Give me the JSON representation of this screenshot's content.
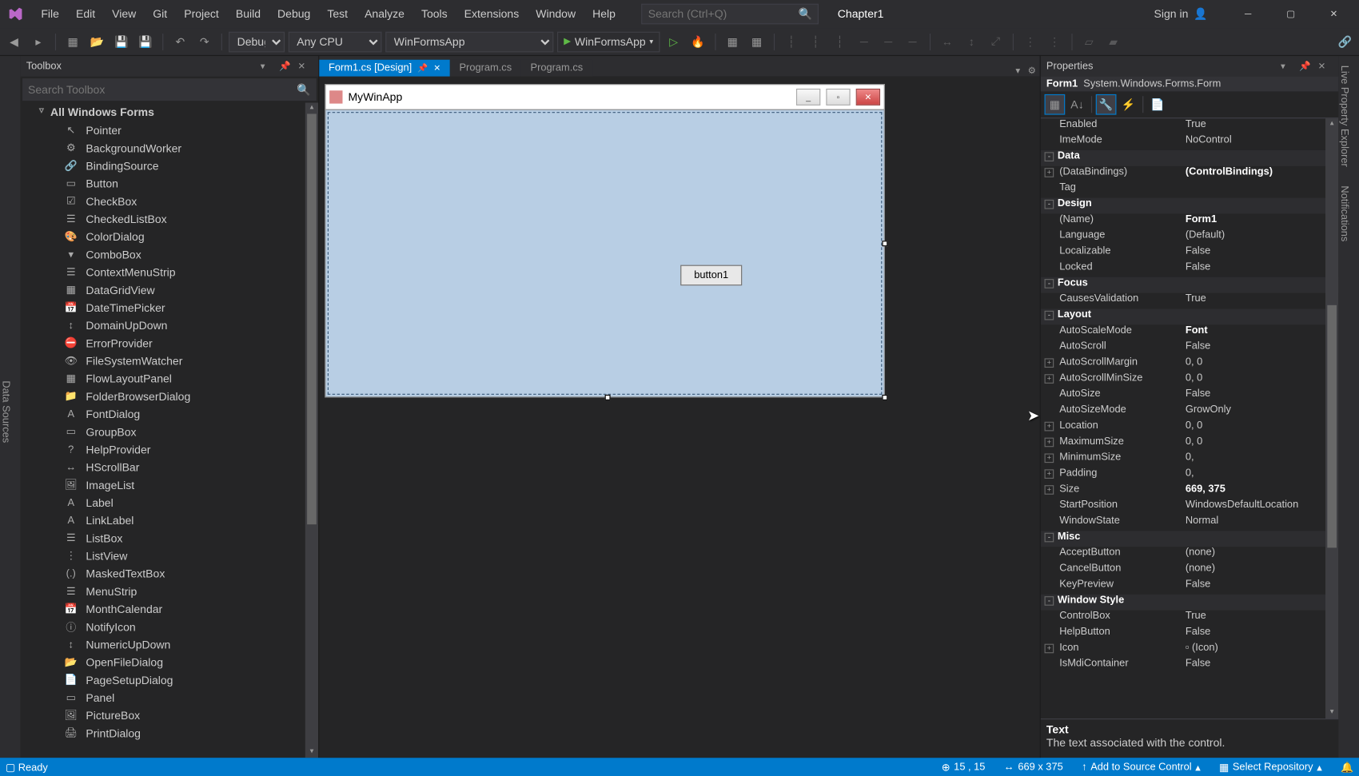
{
  "title": {
    "menu": [
      "File",
      "Edit",
      "View",
      "Git",
      "Project",
      "Build",
      "Debug",
      "Test",
      "Analyze",
      "Tools",
      "Extensions",
      "Window",
      "Help"
    ],
    "search_placeholder": "Search (Ctrl+Q)",
    "solution": "Chapter1",
    "signin": "Sign in"
  },
  "toolbar": {
    "config": "Debug",
    "platform": "Any CPU",
    "startup": "WinFormsApp",
    "run": "WinFormsApp"
  },
  "toolbox": {
    "title": "Toolbox",
    "search_placeholder": "Search Toolbox",
    "category": "All Windows Forms",
    "items": [
      "Pointer",
      "BackgroundWorker",
      "BindingSource",
      "Button",
      "CheckBox",
      "CheckedListBox",
      "ColorDialog",
      "ComboBox",
      "ContextMenuStrip",
      "DataGridView",
      "DateTimePicker",
      "DomainUpDown",
      "ErrorProvider",
      "FileSystemWatcher",
      "FlowLayoutPanel",
      "FolderBrowserDialog",
      "FontDialog",
      "GroupBox",
      "HelpProvider",
      "HScrollBar",
      "ImageList",
      "Label",
      "LinkLabel",
      "ListBox",
      "ListView",
      "MaskedTextBox",
      "MenuStrip",
      "MonthCalendar",
      "NotifyIcon",
      "NumericUpDown",
      "OpenFileDialog",
      "PageSetupDialog",
      "Panel",
      "PictureBox",
      "PrintDialog"
    ]
  },
  "tabs": {
    "active": "Form1.cs [Design]",
    "others": [
      "Program.cs",
      "Program.cs"
    ]
  },
  "form": {
    "title": "MyWinApp",
    "button": "button1"
  },
  "properties": {
    "title": "Properties",
    "object_name": "Form1",
    "object_type": "System.Windows.Forms.Form",
    "rows": [
      {
        "name": "Enabled",
        "val": "True",
        "cat": false
      },
      {
        "name": "ImeMode",
        "val": "NoControl",
        "cat": false
      },
      {
        "name": "Data",
        "val": "",
        "cat": true
      },
      {
        "name": "(DataBindings)",
        "val": "(ControlBindings)",
        "bold": true,
        "exp": true
      },
      {
        "name": "Tag",
        "val": ""
      },
      {
        "name": "Design",
        "val": "",
        "cat": true
      },
      {
        "name": "(Name)",
        "val": "Form1",
        "bold": true
      },
      {
        "name": "Language",
        "val": "(Default)"
      },
      {
        "name": "Localizable",
        "val": "False"
      },
      {
        "name": "Locked",
        "val": "False"
      },
      {
        "name": "Focus",
        "val": "",
        "cat": true
      },
      {
        "name": "CausesValidation",
        "val": "True"
      },
      {
        "name": "Layout",
        "val": "",
        "cat": true
      },
      {
        "name": "AutoScaleMode",
        "val": "Font",
        "bold": true
      },
      {
        "name": "AutoScroll",
        "val": "False"
      },
      {
        "name": "AutoScrollMargin",
        "val": "0, 0",
        "exp": true
      },
      {
        "name": "AutoScrollMinSize",
        "val": "0, 0",
        "exp": true
      },
      {
        "name": "AutoSize",
        "val": "False"
      },
      {
        "name": "AutoSizeMode",
        "val": "GrowOnly"
      },
      {
        "name": "Location",
        "val": "0, 0",
        "exp": true
      },
      {
        "name": "MaximumSize",
        "val": "0, 0",
        "exp": true
      },
      {
        "name": "MinimumSize",
        "val": "0,",
        "exp": true
      },
      {
        "name": "Padding",
        "val": "0,",
        "exp": true
      },
      {
        "name": "Size",
        "val": "669, 375",
        "bold": true,
        "exp": true
      },
      {
        "name": "StartPosition",
        "val": "WindowsDefaultLocation"
      },
      {
        "name": "WindowState",
        "val": "Normal"
      },
      {
        "name": "Misc",
        "val": "",
        "cat": true
      },
      {
        "name": "AcceptButton",
        "val": "(none)"
      },
      {
        "name": "CancelButton",
        "val": "(none)"
      },
      {
        "name": "KeyPreview",
        "val": "False"
      },
      {
        "name": "Window Style",
        "val": "",
        "cat": true
      },
      {
        "name": "ControlBox",
        "val": "True"
      },
      {
        "name": "HelpButton",
        "val": "False"
      },
      {
        "name": "Icon",
        "val": "(Icon)",
        "exp": true,
        "icon": true
      },
      {
        "name": "IsMdiContainer",
        "val": "False"
      }
    ],
    "desc_title": "Text",
    "desc_body": "The text associated with the control."
  },
  "status": {
    "ready": "Ready",
    "pos": "15 , 15",
    "size": "669 x 375",
    "src": "Add to Source Control",
    "repo": "Select Repository"
  },
  "right_tabs": [
    "Live Property Explorer",
    "Notifications"
  ],
  "left_tabs": [
    "Data Sources"
  ]
}
